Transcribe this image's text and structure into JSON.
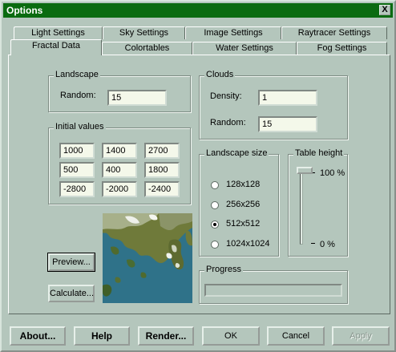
{
  "window": {
    "title": "Options",
    "close_label": "X"
  },
  "tabs": {
    "back": [
      "Light Settings",
      "Sky Settings",
      "Image Settings",
      "Raytracer Settings"
    ],
    "front": [
      "Fractal Data",
      "Colortables",
      "Water Settings",
      "Fog Settings"
    ],
    "active": "Fractal Data"
  },
  "landscape": {
    "legend": "Landscape",
    "random_label": "Random:",
    "random_value": "15"
  },
  "clouds": {
    "legend": "Clouds",
    "density_label": "Density:",
    "density_value": "1",
    "random_label": "Random:",
    "random_value": "15"
  },
  "initial_values": {
    "legend": "Initial values",
    "rows": [
      [
        "1000",
        "1400",
        "2700"
      ],
      [
        "500",
        "400",
        "1800"
      ],
      [
        "-2800",
        "-2000",
        "-2400"
      ]
    ]
  },
  "landscape_size": {
    "legend": "Landscape size",
    "options": [
      "128x128",
      "256x256",
      "512x512",
      "1024x1024"
    ],
    "selected": "512x512"
  },
  "table_height": {
    "legend": "Table height",
    "max_label": "100 %",
    "min_label": "0 %",
    "value_percent": 100
  },
  "progress": {
    "legend": "Progress",
    "value_percent": 0
  },
  "actions": {
    "preview": "Preview...",
    "calculate": "Calculate..."
  },
  "footer": {
    "about": "About...",
    "help": "Help",
    "render": "Render...",
    "ok": "OK",
    "cancel": "Cancel",
    "apply": "Apply"
  },
  "colors": {
    "titlebar": "#0a6b10",
    "dialog": "#b4c6bc",
    "field": "#f4f8ea"
  }
}
